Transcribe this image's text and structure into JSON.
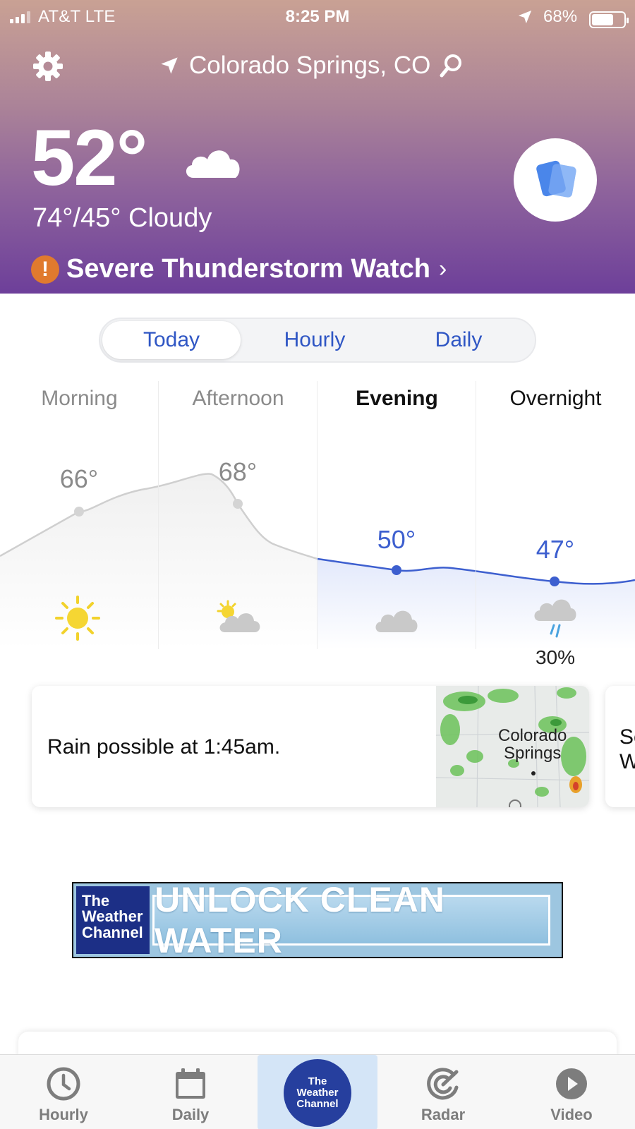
{
  "status_bar": {
    "carrier": "AT&T  LTE",
    "time": "8:25 PM",
    "battery_pct": "68%",
    "battery_level": 0.68,
    "icons": [
      "signal-icon",
      "location-arrow-icon",
      "battery-icon"
    ]
  },
  "header": {
    "location": "Colorado Springs, CO",
    "current_temp": "52°",
    "hi_lo_condition": "74°/45° Cloudy",
    "alert_label": "Severe Thunderstorm Watch",
    "alert_icon": "!",
    "alert_chevron": "›",
    "icons": [
      "gear-icon",
      "location-arrow-icon",
      "search-icon",
      "cloud-icon",
      "cards-icon"
    ],
    "colors": {
      "gradient_top": "#c9a194",
      "gradient_bottom": "#6d3f9a",
      "alert": "#e07a2e"
    }
  },
  "segmented_control": {
    "tabs": [
      {
        "label": "Today",
        "active": true
      },
      {
        "label": "Hourly",
        "active": false
      },
      {
        "label": "Daily",
        "active": false
      }
    ],
    "accent_color": "#2f56c4"
  },
  "dayparts": [
    {
      "label": "Morning",
      "temp": "66°",
      "icon": "sun-icon",
      "precip": ""
    },
    {
      "label": "Afternoon",
      "temp": "68°",
      "icon": "partly-cloudy-icon",
      "precip": ""
    },
    {
      "label": "Evening",
      "temp": "50°",
      "icon": "cloud-icon",
      "precip": ""
    },
    {
      "label": "Overnight",
      "temp": "47°",
      "icon": "rain-cloud-icon",
      "precip": "30%"
    }
  ],
  "insight_card": {
    "text": "Rain possible at 1:45am.",
    "map_label_line1": "Colorado",
    "map_label_line2": "Springs"
  },
  "next_card": {
    "text": "Se\nW"
  },
  "ad": {
    "logo_lines": [
      "The",
      "Weather",
      "Channel"
    ],
    "headline": "UNLOCK CLEAN WATER"
  },
  "tab_bar": {
    "tabs": [
      {
        "label": "Hourly",
        "icon": "clock-icon"
      },
      {
        "label": "Daily",
        "icon": "calendar-icon"
      },
      {
        "label": "",
        "icon": "twc-logo"
      },
      {
        "label": "Radar",
        "icon": "radar-icon"
      },
      {
        "label": "Video",
        "icon": "play-icon"
      }
    ],
    "center_logo_lines": [
      "The",
      "Weather",
      "Channel"
    ]
  }
}
